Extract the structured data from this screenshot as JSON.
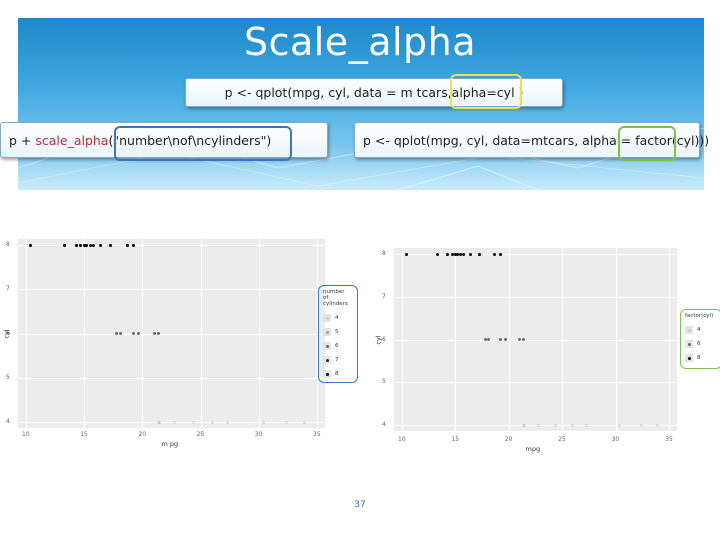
{
  "slide": {
    "title": "Scale_alpha",
    "page_number": "37"
  },
  "code": {
    "top": "p <- qplot(mpg, cyl, data = m tcars,alpha=cyl )",
    "left_prefix": "p + ",
    "left_fn": "scale_alpha",
    "left_args": "(\"number\\nof\\ncylinders\")",
    "right": "p <- qplot(mpg, cyl, data=mtcars, alpha = factor(cyl)))"
  },
  "colors": {
    "header_blue": "#1e88c9",
    "highlight_yellow": "#e7e25a",
    "highlight_blue": "#3b74bf",
    "highlight_green": "#7bc24a",
    "function_red": "#b1303a"
  },
  "chart_data": [
    {
      "type": "scatter",
      "xlabel": "m pg",
      "ylabel": "cyl",
      "xlim": [
        10,
        35
      ],
      "ylim": [
        4,
        8
      ],
      "x_ticks": [
        "10",
        "15",
        "20",
        "25",
        "30",
        "35"
      ],
      "y_ticks": [
        "4",
        "5",
        "6",
        "7",
        "8"
      ],
      "legend": {
        "title": "number\nof\ncylinders",
        "entries": [
          {
            "label": "4",
            "alpha": 0.1
          },
          {
            "label": "5",
            "alpha": 0.3
          },
          {
            "label": "6",
            "alpha": 0.55
          },
          {
            "label": "7",
            "alpha": 0.8
          },
          {
            "label": "8",
            "alpha": 1.0
          }
        ]
      },
      "points": [
        {
          "x": 10.4,
          "y": 8
        },
        {
          "x": 13.3,
          "y": 8
        },
        {
          "x": 14.3,
          "y": 8
        },
        {
          "x": 14.7,
          "y": 8
        },
        {
          "x": 15.0,
          "y": 8
        },
        {
          "x": 15.2,
          "y": 8
        },
        {
          "x": 15.5,
          "y": 8
        },
        {
          "x": 15.8,
          "y": 8
        },
        {
          "x": 16.4,
          "y": 8
        },
        {
          "x": 17.3,
          "y": 8
        },
        {
          "x": 18.7,
          "y": 8
        },
        {
          "x": 19.2,
          "y": 8
        },
        {
          "x": 17.8,
          "y": 6
        },
        {
          "x": 18.1,
          "y": 6
        },
        {
          "x": 19.2,
          "y": 6
        },
        {
          "x": 19.7,
          "y": 6
        },
        {
          "x": 21.0,
          "y": 6
        },
        {
          "x": 21.4,
          "y": 6
        },
        {
          "x": 21.4,
          "y": 4
        },
        {
          "x": 21.5,
          "y": 4
        },
        {
          "x": 22.8,
          "y": 4
        },
        {
          "x": 24.4,
          "y": 4
        },
        {
          "x": 26.0,
          "y": 4
        },
        {
          "x": 27.3,
          "y": 4
        },
        {
          "x": 30.4,
          "y": 4
        },
        {
          "x": 32.4,
          "y": 4
        },
        {
          "x": 33.9,
          "y": 4
        }
      ]
    },
    {
      "type": "scatter",
      "xlabel": "mpg",
      "ylabel": "cyl",
      "xlim": [
        10,
        35
      ],
      "ylim": [
        4,
        8
      ],
      "x_ticks": [
        "10",
        "15",
        "20",
        "25",
        "30",
        "35"
      ],
      "y_ticks": [
        "4",
        "5",
        "6",
        "7",
        "8"
      ],
      "legend": {
        "title": "factor(cyl)",
        "entries": [
          {
            "label": "4",
            "alpha": 0.1
          },
          {
            "label": "6",
            "alpha": 0.55
          },
          {
            "label": "8",
            "alpha": 1.0
          }
        ]
      },
      "points": [
        {
          "x": 10.4,
          "y": 8
        },
        {
          "x": 13.3,
          "y": 8
        },
        {
          "x": 14.3,
          "y": 8
        },
        {
          "x": 14.7,
          "y": 8
        },
        {
          "x": 15.0,
          "y": 8
        },
        {
          "x": 15.2,
          "y": 8
        },
        {
          "x": 15.5,
          "y": 8
        },
        {
          "x": 15.8,
          "y": 8
        },
        {
          "x": 16.4,
          "y": 8
        },
        {
          "x": 17.3,
          "y": 8
        },
        {
          "x": 18.7,
          "y": 8
        },
        {
          "x": 19.2,
          "y": 8
        },
        {
          "x": 17.8,
          "y": 6
        },
        {
          "x": 18.1,
          "y": 6
        },
        {
          "x": 19.2,
          "y": 6
        },
        {
          "x": 19.7,
          "y": 6
        },
        {
          "x": 21.0,
          "y": 6
        },
        {
          "x": 21.4,
          "y": 6
        },
        {
          "x": 21.4,
          "y": 4
        },
        {
          "x": 21.5,
          "y": 4
        },
        {
          "x": 22.8,
          "y": 4
        },
        {
          "x": 24.4,
          "y": 4
        },
        {
          "x": 26.0,
          "y": 4
        },
        {
          "x": 27.3,
          "y": 4
        },
        {
          "x": 30.4,
          "y": 4
        },
        {
          "x": 32.4,
          "y": 4
        },
        {
          "x": 33.9,
          "y": 4
        }
      ]
    }
  ]
}
